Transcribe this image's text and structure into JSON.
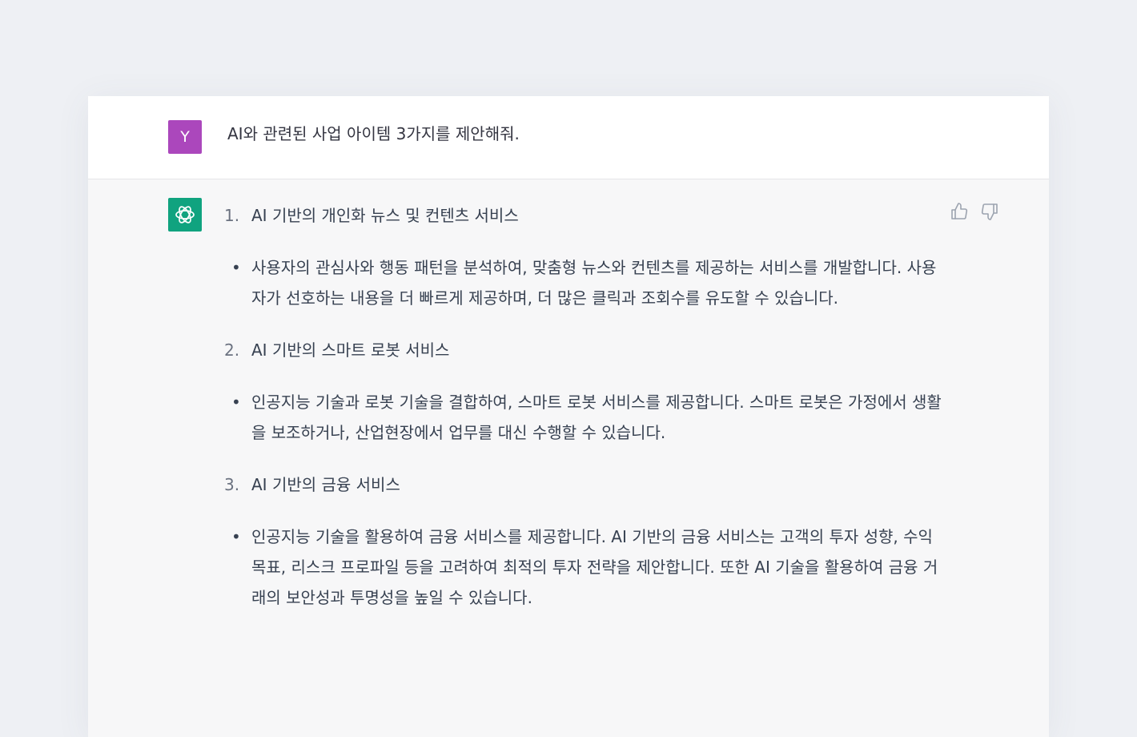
{
  "user_message": {
    "avatar_letter": "Y",
    "avatar_color": "#ab47bc",
    "text": "AI와 관련된 사업 아이템 3가지를 제안해줘."
  },
  "assistant_message": {
    "avatar_icon": "openai-logo-icon",
    "avatar_color": "#10a37f",
    "items": [
      {
        "number": "1.",
        "title": "AI 기반의 개인화 뉴스 및 컨텐츠 서비스",
        "bullet": "사용자의 관심사와 행동 패턴을 분석하여, 맞춤형 뉴스와 컨텐츠를 제공하는 서비스를 개발합니다. 사용자가 선호하는 내용을 더 빠르게 제공하며, 더 많은 클릭과 조회수를 유도할 수 있습니다."
      },
      {
        "number": "2.",
        "title": "AI 기반의 스마트 로봇 서비스",
        "bullet": "인공지능 기술과 로봇 기술을 결합하여, 스마트 로봇 서비스를 제공합니다. 스마트 로봇은 가정에서 생활을 보조하거나, 산업현장에서 업무를 대신 수행할 수 있습니다."
      },
      {
        "number": "3.",
        "title": "AI 기반의 금융 서비스",
        "bullet": "인공지능 기술을 활용하여 금융 서비스를 제공합니다. AI 기반의 금융 서비스는 고객의 투자 성향, 수익 목표, 리스크 프로파일 등을 고려하여 최적의 투자 전략을 제안합니다. 또한 AI 기술을 활용하여 금융 거래의 보안성과 투명성을 높일 수 있습니다."
      }
    ],
    "bullet_glyph": "•"
  },
  "feedback": {
    "like_icon": "thumbs-up-icon",
    "dislike_icon": "thumbs-down-icon"
  }
}
